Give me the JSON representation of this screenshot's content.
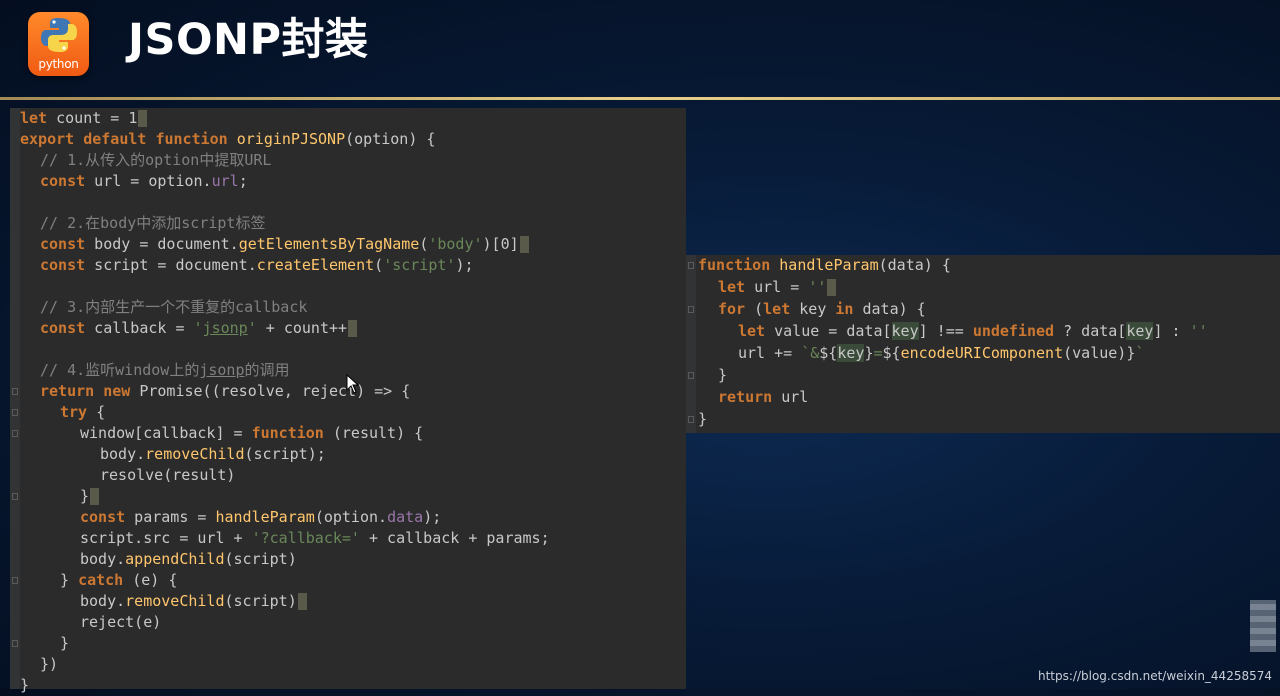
{
  "header": {
    "logo_text": "python",
    "title": "JSONP封装"
  },
  "left_code": [
    "let count = 1",
    "export default function originPJSONP(option) {",
    "  // 1.从传入的option中提取URL",
    "  const url = option.url;",
    "",
    "  // 2.在body中添加script标签",
    "  const body = document.getElementsByTagName('body')[0]",
    "  const script = document.createElement('script');",
    "",
    "  // 3.内部生产一个不重复的callback",
    "  const callback = 'jsonp' + count++",
    "",
    "  // 4.监听window上的jsonp的调用",
    "  return new Promise((resolve, reject) => {",
    "    try {",
    "      window[callback] = function (result) {",
    "        body.removeChild(script);",
    "        resolve(result)",
    "      }",
    "      const params = handleParam(option.data);",
    "      script.src = url + '?callback=' + callback + params;",
    "      body.appendChild(script)",
    "    } catch (e) {",
    "      body.removeChild(script)",
    "      reject(e)",
    "    }",
    "  })",
    "}"
  ],
  "right_code": [
    "function handleParam(data) {",
    "  let url = ''",
    "  for (let key in data) {",
    "    let value = data[key] !== undefined ? data[key] : ''",
    "    url += `&${key}=${encodeURIComponent(value)}`",
    "  }",
    "  return url",
    "}"
  ],
  "watermark": "https://blog.csdn.net/weixin_44258574",
  "colors": {
    "keyword": "#cc7832",
    "string": "#6a8759",
    "comment": "#808080",
    "function": "#ffc66d",
    "property": "#9876aa",
    "panel_bg": "#2b2b2b",
    "divider": "#e7cf8a"
  },
  "icons": {
    "logo": "python-logo-icon",
    "cursor": "mouse-pointer-icon"
  }
}
